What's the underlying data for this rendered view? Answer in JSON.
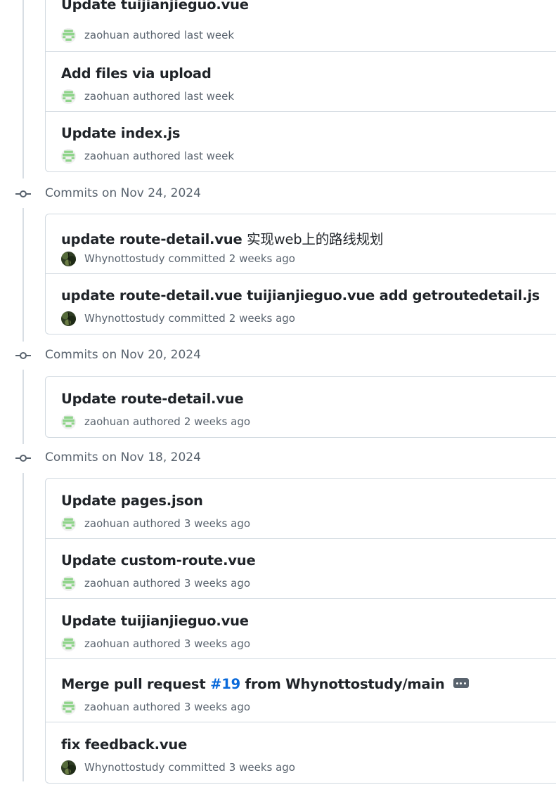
{
  "groups": [
    {
      "label": "",
      "commits": [
        {
          "title": "Update tuijianjieguo.vue",
          "author": "zaohuan",
          "action": "authored",
          "time": "last week",
          "avatar": "identicon"
        },
        {
          "title": "Add files via upload",
          "author": "zaohuan",
          "action": "authored",
          "time": "last week",
          "avatar": "identicon"
        },
        {
          "title": "Update index.js",
          "author": "zaohuan",
          "action": "authored",
          "time": "last week",
          "avatar": "identicon"
        }
      ]
    },
    {
      "label": "Commits on Nov 24, 2024",
      "commits": [
        {
          "title": "update route-detail.vue",
          "title_cn": "实现web上的路线规划",
          "author": "Whynottostudy",
          "action": "committed",
          "time": "2 weeks ago",
          "avatar": "photo"
        },
        {
          "title": "update route-detail.vue tuijianjieguo.vue add getroutedetail.js",
          "author": "Whynottostudy",
          "action": "committed",
          "time": "2 weeks ago",
          "avatar": "photo"
        }
      ]
    },
    {
      "label": "Commits on Nov 20, 2024",
      "commits": [
        {
          "title": "Update route-detail.vue",
          "author": "zaohuan",
          "action": "authored",
          "time": "2 weeks ago",
          "avatar": "identicon"
        }
      ]
    },
    {
      "label": "Commits on Nov 18, 2024",
      "commits": [
        {
          "title": "Update pages.json",
          "author": "zaohuan",
          "action": "authored",
          "time": "3 weeks ago",
          "avatar": "identicon"
        },
        {
          "title": "Update custom-route.vue",
          "author": "zaohuan",
          "action": "authored",
          "time": "3 weeks ago",
          "avatar": "identicon"
        },
        {
          "title": "Update tuijianjieguo.vue",
          "author": "zaohuan",
          "action": "authored",
          "time": "3 weeks ago",
          "avatar": "identicon"
        },
        {
          "title": "Merge pull request",
          "pr_link": "#19",
          "title_tail": "from Whynottostudy/main",
          "has_ellipsis": true,
          "author": "zaohuan",
          "action": "authored",
          "time": "3 weeks ago",
          "avatar": "identicon"
        },
        {
          "title": "fix feedback.vue",
          "author": "Whynottostudy",
          "action": "committed",
          "time": "3 weeks ago",
          "avatar": "photo"
        }
      ]
    }
  ],
  "colors": {
    "link": "#0969da",
    "muted": "#59636e",
    "border": "#d1d9e0",
    "identicon_green": "#8fd48a",
    "photo_dark": "#2f3d24"
  }
}
